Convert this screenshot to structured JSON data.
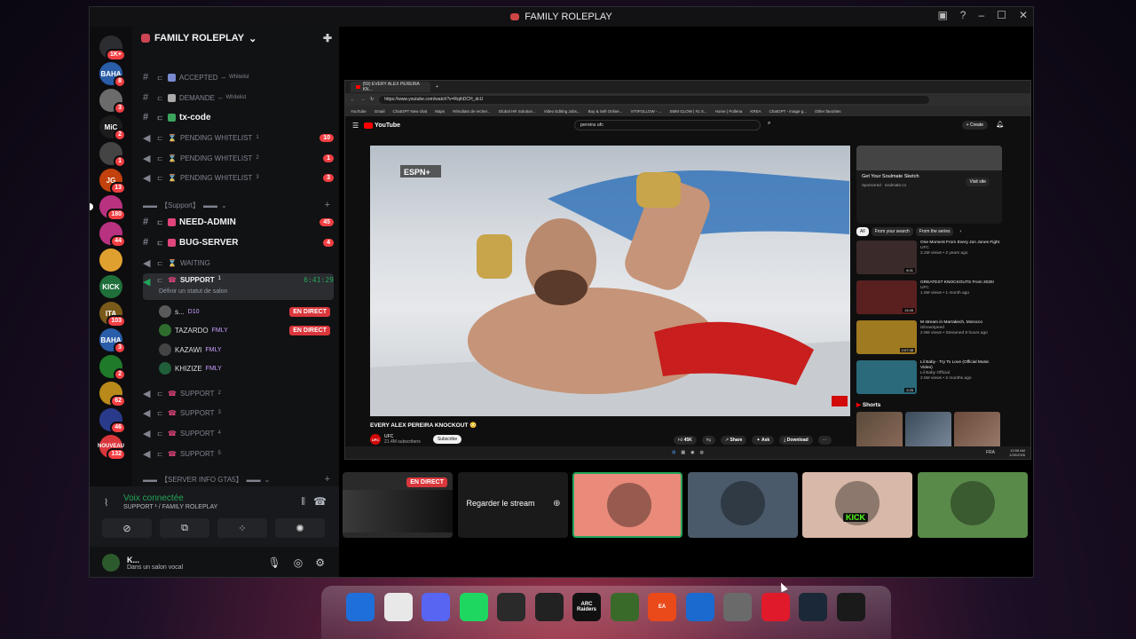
{
  "window": {
    "title": "FAMILY ROLEPLAY"
  },
  "servers": [
    {
      "label": "",
      "badge": "1K+",
      "color": "#2b2d31"
    },
    {
      "label": "BAHA",
      "badge": "8",
      "color": "#2a5da8"
    },
    {
      "label": "",
      "badge": "3",
      "color": "#6b6b6b"
    },
    {
      "label": "MiC",
      "badge": "2",
      "color": "#1c1c1c"
    },
    {
      "label": "",
      "badge": "1",
      "color": "#444"
    },
    {
      "label": "JG",
      "badge": "13",
      "color": "#c2410c"
    },
    {
      "label": "",
      "badge": "180",
      "color": "#b83280"
    },
    {
      "label": "",
      "badge": "44",
      "color": "#b83280"
    },
    {
      "label": "",
      "badge": "",
      "color": "#e0a030"
    },
    {
      "label": "KICK",
      "badge": "",
      "color": "#1f6f3a"
    },
    {
      "label": "ITA",
      "badge": "103",
      "color": "#7a5a1a"
    },
    {
      "label": "BAHA",
      "badge": "3",
      "color": "#2a5da8"
    },
    {
      "label": "",
      "badge": "2",
      "color": "#1f7a2a"
    },
    {
      "label": "",
      "badge": "62",
      "color": "#b98a1a"
    },
    {
      "label": "",
      "badge": "46",
      "color": "#2a3a8a"
    },
    {
      "label": "NOUVEAU",
      "badge": "132",
      "color": "#da373c"
    }
  ],
  "guild": {
    "name": "FAMILY ROLEPLAY"
  },
  "channels": {
    "accepted": "ACCEPTED",
    "accepted_sup": "Whitelist",
    "demande": "DEMANDE",
    "demande_sup": "Whitelist",
    "txcode": "tx-code",
    "pending1": "PENDING WHITELIST",
    "pending1_sup": "1",
    "pending1_count": "10",
    "pending2": "PENDING WHITELIST",
    "pending2_sup": "2",
    "pending2_count": "1",
    "pending3": "PENDING WHITELIST",
    "pending3_sup": "3",
    "pending3_count": "3",
    "cat_support": "【Support】",
    "need_admin": "NEED-ADMIN",
    "need_admin_count": "45",
    "bug_server": "BUG-SERVER",
    "bug_server_count": "4",
    "waiting": "WAITING",
    "support1": "SUPPORT",
    "support1_sup": "1",
    "support1_timer": "6:41:29",
    "support1_status": "Définir un statut de salon",
    "support2": "SUPPORT",
    "support2_sup": "2",
    "support3": "SUPPORT",
    "support3_sup": "3",
    "support4": "SUPPORT",
    "support4_sup": "4",
    "support5": "SUPPORT",
    "support5_sup": "5",
    "cat_server_info": "【SERVER INFO GTA5】"
  },
  "members": [
    {
      "name": "s...",
      "tag": "D10",
      "live": "",
      "color": "#5a5a5a"
    },
    {
      "name": "TAZARDO",
      "tag": "FMLY",
      "live": "EN DIRECT",
      "color": "#2f6d2f"
    },
    {
      "name": "KAZAWI",
      "tag": "FMLY",
      "live": "",
      "color": "#444"
    },
    {
      "name": "KHIZIZE",
      "tag": "FMLY",
      "live": "",
      "color": "#1f5f3a"
    }
  ],
  "member_live_1": "EN DIRECT",
  "voice": {
    "status": "Voix connectée",
    "channel": "SUPPORT ¹ / FAMILY ROLEPLAY"
  },
  "user": {
    "name": "K...",
    "status": "Dans un salon vocal"
  },
  "browser": {
    "tab": "(59) EVERY ALEX PEREIRA KN...",
    "url": "https://www.youtube.com/watch?v=RqihDCH_dcU",
    "bookmarks": [
      "YouTube",
      "Gmail",
      "ChatGPT New chat",
      "Maps",
      "Résultats de recher...",
      "Global HR Solution...",
      "Video Editing Jobs...",
      "Buy & Sell Online...",
      "VITIFOLLOW - ...",
      "SMM GLOW | #1 S...",
      "Home | Pollena",
      "KREA",
      "ChatGPT - image g...",
      "Other favorites"
    ]
  },
  "youtube": {
    "logo": "YouTube",
    "search": "pereira ufc",
    "create": "Create",
    "video_title": "EVERY ALEX PEREIRA KNOCKOUT 😳",
    "channel": "UFC",
    "subs": "21.4M subscribers",
    "subscribe": "Subscribe",
    "likes": "45K",
    "share": "Share",
    "ask": "Ask",
    "download": "Download",
    "espn": "ESPN+",
    "ad_title": "Get Your Soulmate Sketch",
    "ad_sponsor": "Sponsored · soulmate.co",
    "ad_visit": "Visit site",
    "chips": [
      "All",
      "From your search",
      "From the series"
    ],
    "recs": [
      {
        "title": "One Moment From Every Jon Jones Fight",
        "ch": "UFC",
        "meta": "2.2M views • 2 years ago",
        "dur": "8:31",
        "color": "#3a2a2a"
      },
      {
        "title": "GREATEST KNOCKOUTS From 2025!",
        "ch": "UFC",
        "meta": "1.5M views • 1 month ago",
        "dur": "13:45",
        "color": "#5a2020"
      },
      {
        "title": "M stream in Marrakech, Morocco",
        "ch": "iShowSpeed",
        "meta": "2.9M views • Streamed 9 hours ago",
        "dur": "2:07:38",
        "color": "#a07a20"
      },
      {
        "title": "Lil Baby - Try To Love (Official Music Video)",
        "ch": "Lil Baby Official",
        "meta": "2.5M views • 2 months ago",
        "dur": "2:25",
        "color": "#2a6a7a"
      }
    ],
    "shorts": "Shorts"
  },
  "taskbar_inner": {
    "time": "10:58 AM",
    "date": "1/30/2026",
    "lang": "FRA"
  },
  "streams": [
    {
      "label": "EN DIRECT",
      "kind": "live",
      "color": "#2a2a2a"
    },
    {
      "label": "Regarder le stream",
      "kind": "watch",
      "color": "#1a1a1a"
    },
    {
      "label": "",
      "kind": "user",
      "color": "#e98a7a"
    },
    {
      "label": "",
      "kind": "user",
      "color": "#4a5a6a"
    },
    {
      "label": "KICK",
      "kind": "user",
      "color": "#d8b8a8"
    },
    {
      "label": "",
      "kind": "user",
      "color": "#5a8a4a"
    }
  ],
  "dock": [
    {
      "name": "windows-start",
      "color": "#1e6fd9",
      "label": ""
    },
    {
      "name": "chrome",
      "color": "#e8e8e8",
      "label": ""
    },
    {
      "name": "discord",
      "color": "#5865f2",
      "label": ""
    },
    {
      "name": "spotify",
      "color": "#1ed760",
      "label": ""
    },
    {
      "name": "obs",
      "color": "#2a2a2a",
      "label": ""
    },
    {
      "name": "msi",
      "color": "#222",
      "label": ""
    },
    {
      "name": "arc-raiders",
      "color": "#111",
      "label": "ARC Raiders"
    },
    {
      "name": "nvidia",
      "color": "#3a6a2a",
      "label": ""
    },
    {
      "name": "ea",
      "color": "#ea4a1a",
      "label": "EA"
    },
    {
      "name": "remote",
      "color": "#1a6ad0",
      "label": ""
    },
    {
      "name": "gta",
      "color": "#6a6a6a",
      "label": ""
    },
    {
      "name": "faceit",
      "color": "#e01a2a",
      "label": ""
    },
    {
      "name": "steam",
      "color": "#1b2838",
      "label": ""
    },
    {
      "name": "game",
      "color": "#1a1a1a",
      "label": ""
    }
  ]
}
